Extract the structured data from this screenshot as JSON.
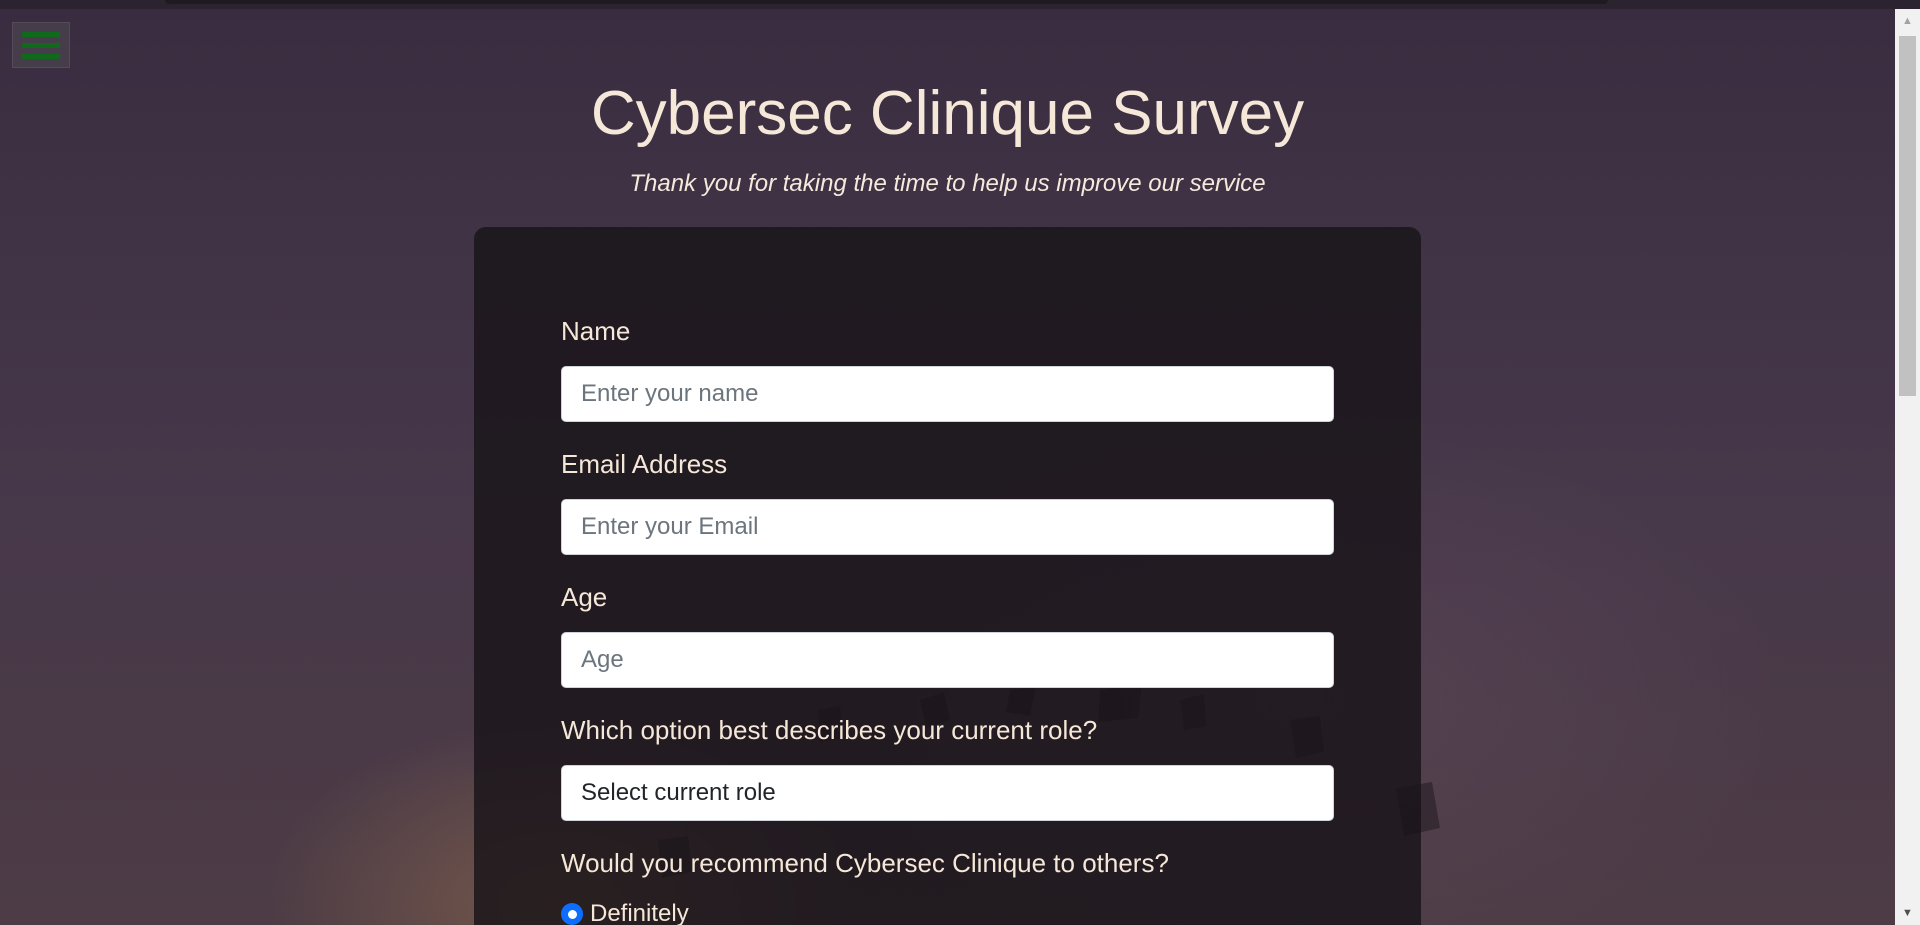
{
  "page": {
    "title": "Cybersec Clinique Survey",
    "subtitle": "Thank you for taking the time to help us improve our service"
  },
  "menu": {
    "icon": "hamburger-menu-icon"
  },
  "form": {
    "name": {
      "label": "Name",
      "placeholder": "Enter your name",
      "value": ""
    },
    "email": {
      "label": "Email Address",
      "placeholder": "Enter your Email",
      "value": ""
    },
    "age": {
      "label": "Age",
      "placeholder": "Age",
      "value": ""
    },
    "role": {
      "label": "Which option best describes your current role?",
      "selected": "Select current role"
    },
    "recommend": {
      "label": "Would you recommend Cybersec Clinique to others?",
      "options": [
        {
          "label": "Definitely",
          "checked": true
        }
      ]
    }
  },
  "colors": {
    "accent": "#0d6efd",
    "menu_bars": "#0f6a1c",
    "text": "#f6e8d8"
  }
}
